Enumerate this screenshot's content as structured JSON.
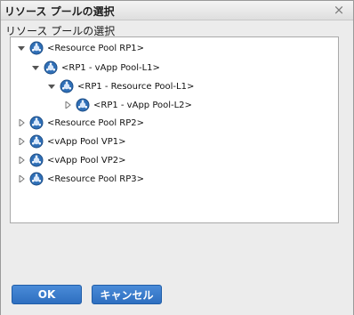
{
  "window": {
    "title": "リソース プールの選択",
    "close_glyph": "×"
  },
  "section_label": "リソース プールの選択",
  "tree": {
    "nodes": [
      {
        "label": "<Resource Pool RP1>",
        "expanded": true
      },
      {
        "label": "<RP1 - vApp Pool-L1>",
        "expanded": true
      },
      {
        "label": "<RP1 - Resource Pool-L1>",
        "expanded": true
      },
      {
        "label": "<RP1 - vApp Pool-L2>",
        "expanded": false
      },
      {
        "label": "<Resource Pool RP2>",
        "expanded": false
      },
      {
        "label": "<vApp Pool VP1>",
        "expanded": false
      },
      {
        "label": "<vApp Pool VP2>",
        "expanded": false
      },
      {
        "label": "<Resource Pool RP3>",
        "expanded": false
      }
    ]
  },
  "buttons": {
    "ok": "OK",
    "cancel": "キャンセル"
  },
  "colors": {
    "primary_button": "#2e6fc0",
    "panel": "#ececec",
    "tree_bg": "#ffffff"
  },
  "icons": {
    "pool": "resource-pool-icon",
    "expand": "triangle-expand-icon",
    "collapse": "triangle-collapse-icon",
    "close": "close-icon"
  }
}
